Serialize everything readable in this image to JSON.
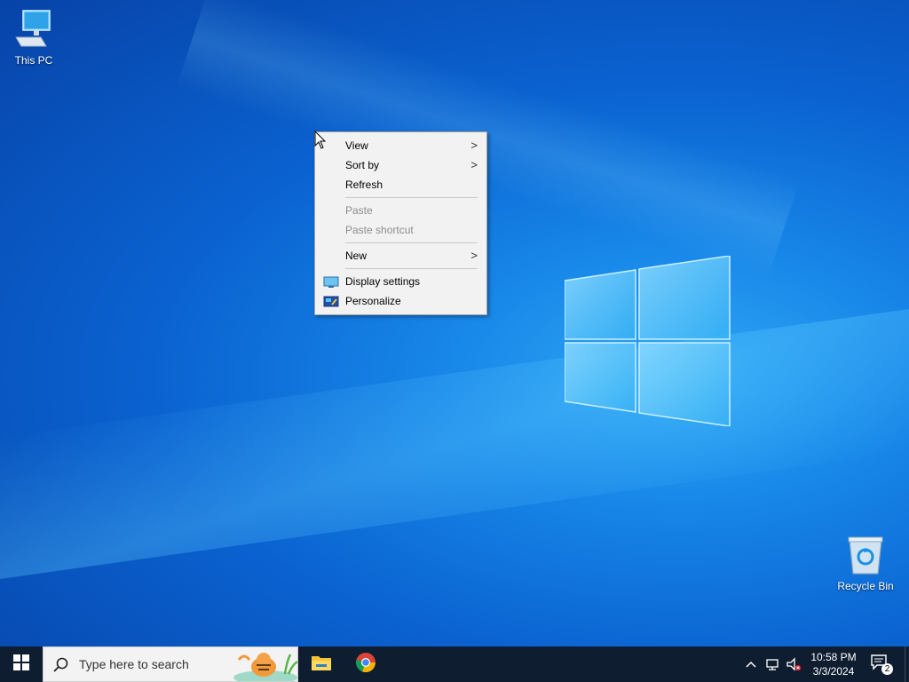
{
  "desktop": {
    "icons": [
      {
        "label": "This PC",
        "icon": "this-pc-icon"
      },
      {
        "label": "Recycle Bin",
        "icon": "recycle-bin-icon"
      }
    ]
  },
  "context_menu": {
    "items": [
      {
        "label": "View",
        "submenu": true,
        "enabled": true
      },
      {
        "label": "Sort by",
        "submenu": true,
        "enabled": true
      },
      {
        "label": "Refresh",
        "submenu": false,
        "enabled": true
      },
      {
        "label": "Paste",
        "submenu": false,
        "enabled": false
      },
      {
        "label": "Paste shortcut",
        "submenu": false,
        "enabled": false
      },
      {
        "label": "New",
        "submenu": true,
        "enabled": true
      },
      {
        "label": "Display settings",
        "submenu": false,
        "enabled": true,
        "icon": "display-settings-icon"
      },
      {
        "label": "Personalize",
        "submenu": false,
        "enabled": true,
        "icon": "personalize-icon"
      }
    ],
    "arrow_glyph": ">"
  },
  "taskbar": {
    "search_placeholder": "Type here to search",
    "pinned": [
      {
        "name": "File Explorer",
        "icon": "file-explorer-icon"
      },
      {
        "name": "Google Chrome",
        "icon": "chrome-icon"
      }
    ],
    "tray": {
      "chevron_icon": "chevron-up-icon",
      "network_icon": "network-icon",
      "volume_icon": "volume-muted-icon",
      "time": "10:58 PM",
      "date": "3/3/2024",
      "notification_count": "2"
    }
  },
  "colors": {
    "taskbar_bg": "#0f1d30",
    "menu_bg": "#f2f2f2",
    "desktop_accent": "#1786e8"
  }
}
